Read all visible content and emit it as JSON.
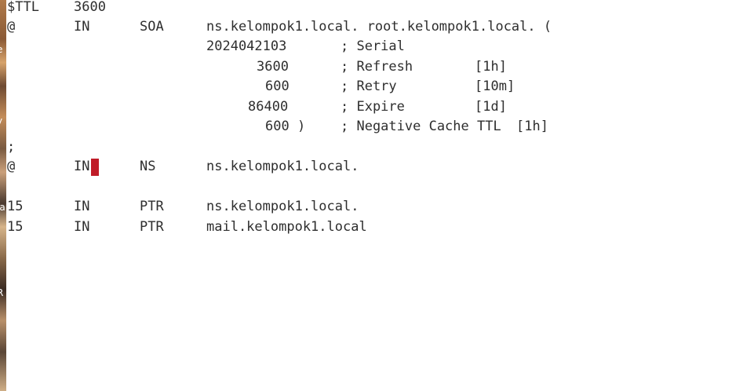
{
  "desktop_edge": {
    "fragments": [
      "e",
      "y",
      "ia",
      "R",
      "/"
    ]
  },
  "zone_file": {
    "ttl_directive": {
      "keyword": "$TTL",
      "value": "3600"
    },
    "soa": {
      "name": "@",
      "class": "IN",
      "type": "SOA",
      "mname_rname": "ns.kelompok1.local. root.kelompok1.local. ("
    },
    "soa_fields": [
      {
        "value": "2024042103",
        "comment": "; Serial",
        "human": ""
      },
      {
        "value": "3600",
        "comment": "; Refresh",
        "human": "[1h]"
      },
      {
        "value": "600",
        "comment": "; Retry",
        "human": "[10m]"
      },
      {
        "value": "86400",
        "comment": "; Expire",
        "human": "[1d]"
      },
      {
        "value": "600 )",
        "comment": "; Negative Cache TTL",
        "human": "[1h]"
      }
    ],
    "separator": ";",
    "ns_record": {
      "name": "@",
      "class": "IN",
      "type": "NS",
      "data": "ns.kelompok1.local."
    },
    "ptr_records": [
      {
        "name": "15",
        "class": "IN",
        "type": "PTR",
        "data": "ns.kelompok1.local."
      },
      {
        "name": "15",
        "class": "IN",
        "type": "PTR",
        "data": "mail.kelompok1.local"
      }
    ]
  },
  "colors": {
    "text": "#2e2e2e",
    "cursor": "#c01c28",
    "background": "#ffffff"
  }
}
